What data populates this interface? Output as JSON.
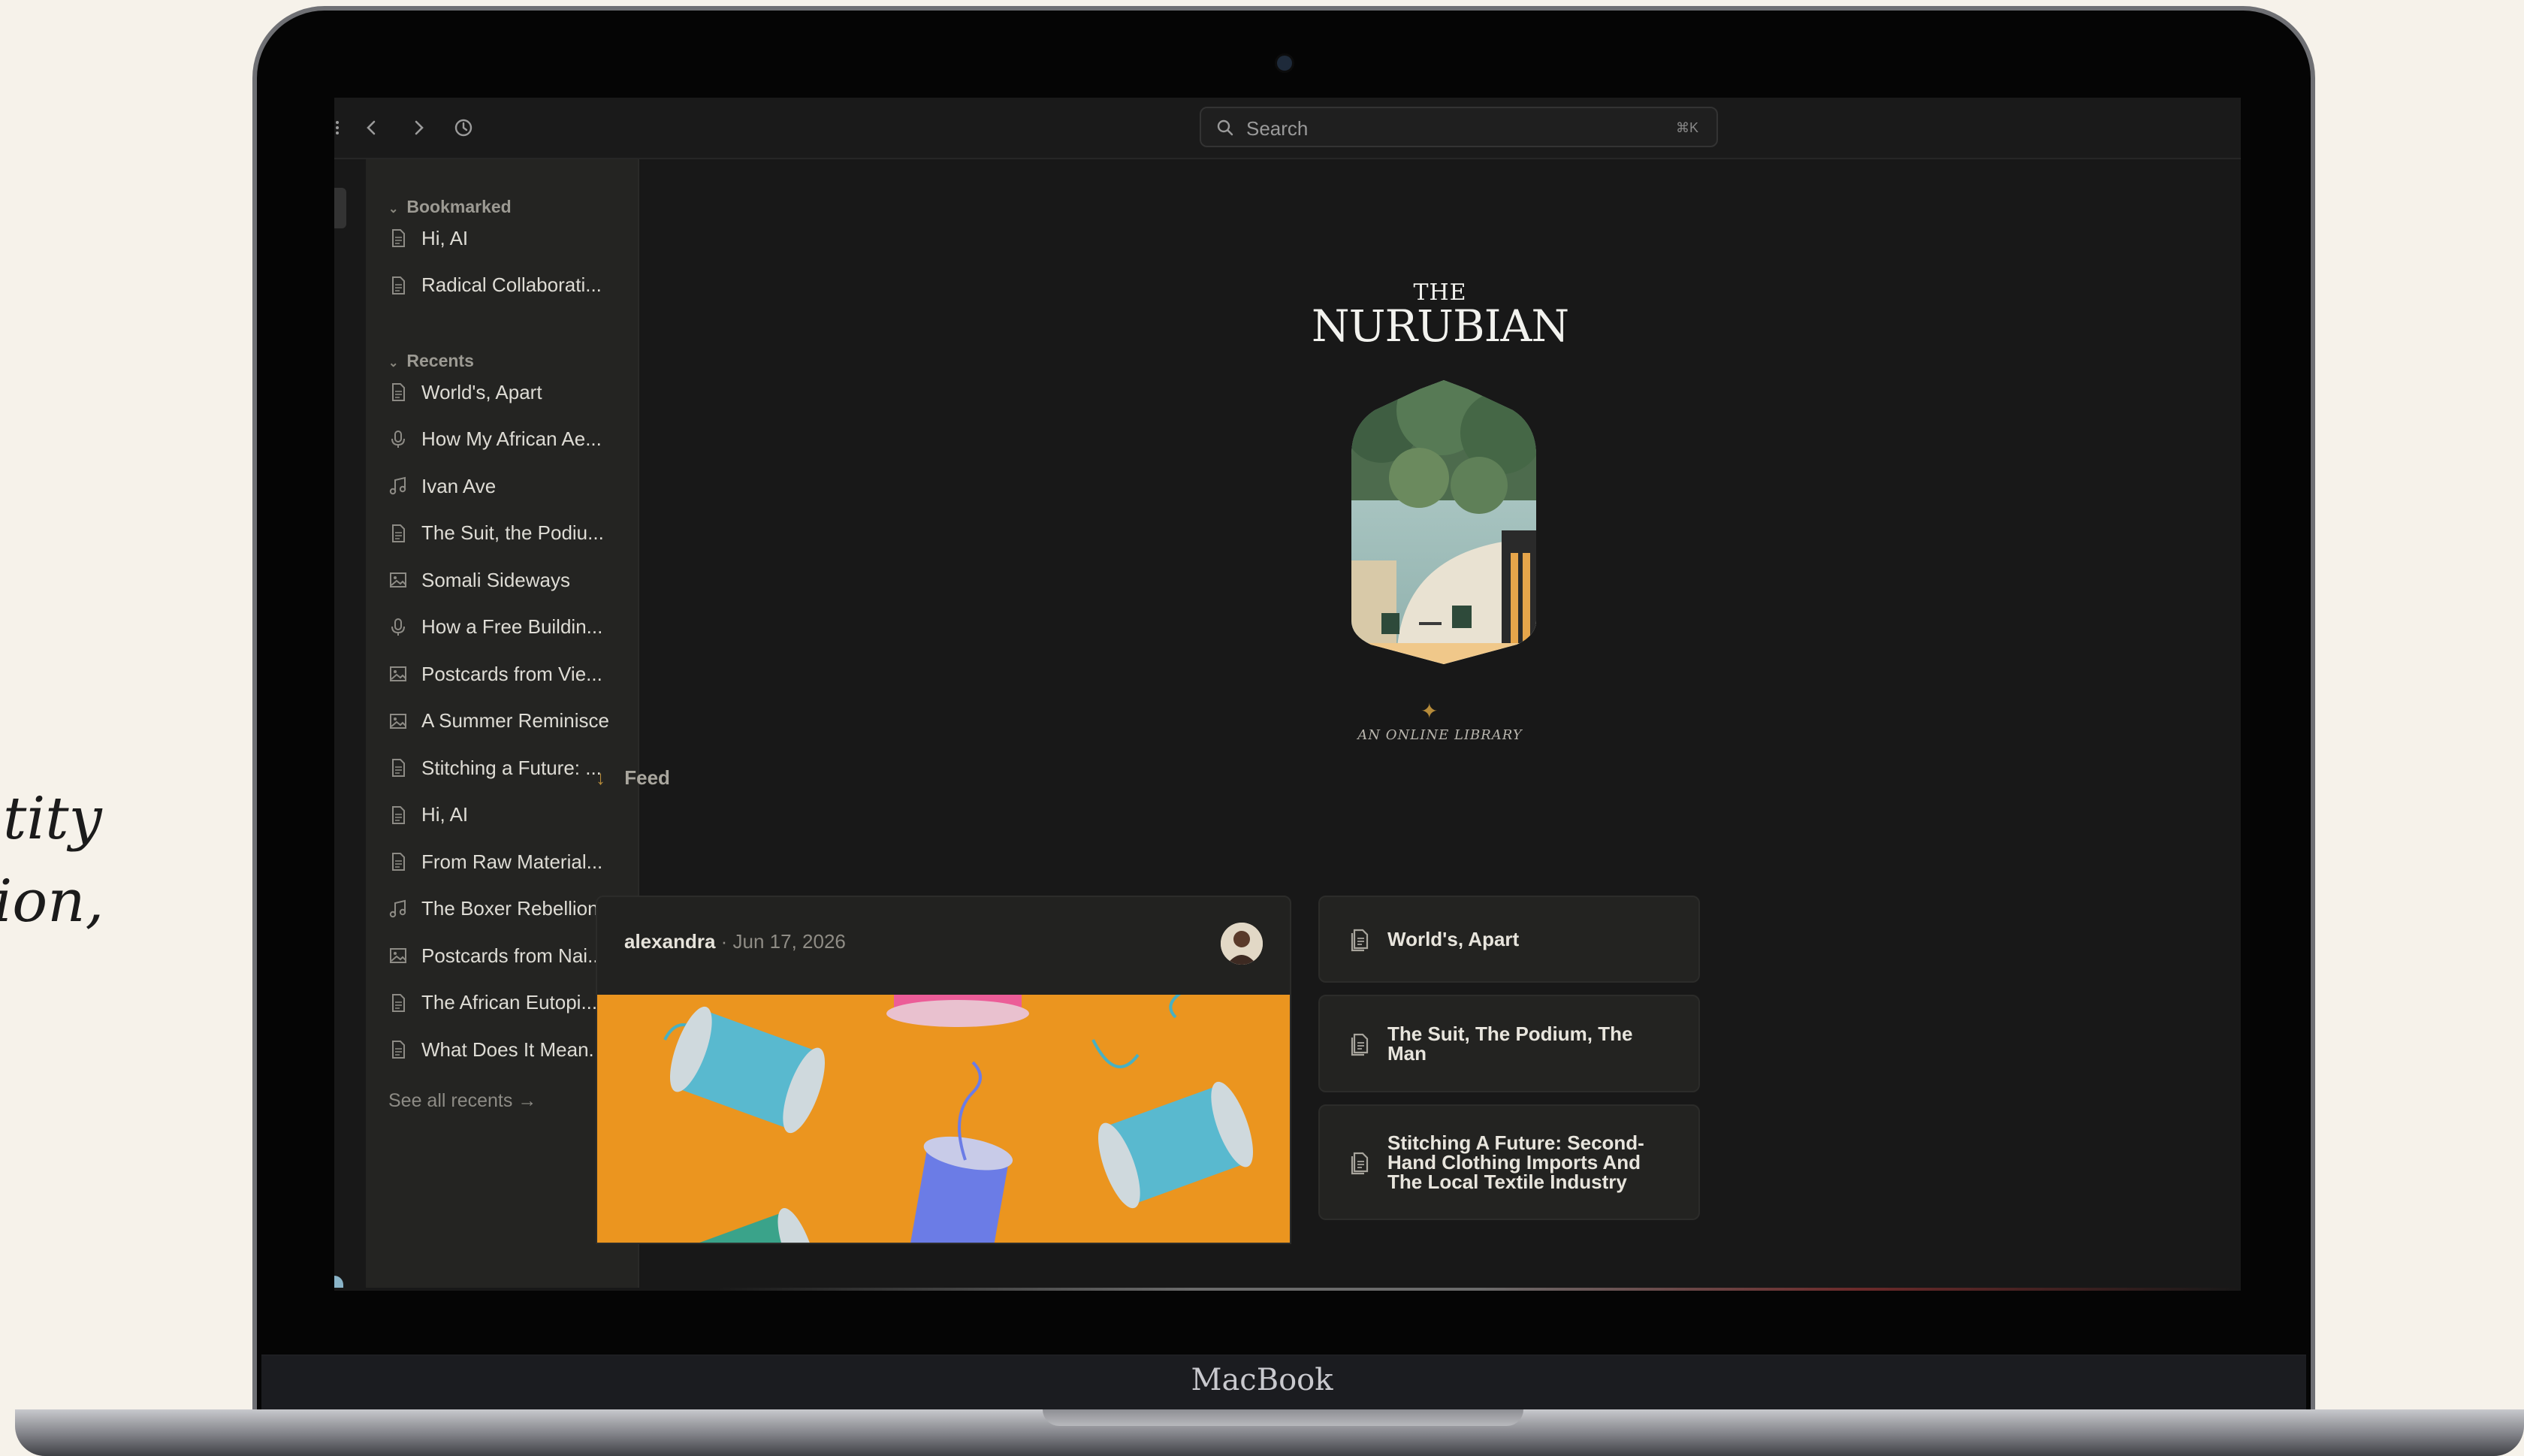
{
  "background_text": {
    "line1": "tity",
    "line2": "tion,"
  },
  "device": {
    "brand": "MacBook"
  },
  "topbar": {
    "icons": [
      "menu-dots-icon",
      "back-icon",
      "forward-icon",
      "history-icon"
    ],
    "search": {
      "placeholder": "Search",
      "shortcut": "⌘K"
    }
  },
  "sidebar": {
    "bookmarked": {
      "title": "Bookmarked",
      "items": [
        {
          "label": "Hi, AI",
          "icon": "document-icon"
        },
        {
          "label": "Radical Collaborati...",
          "icon": "document-icon"
        }
      ]
    },
    "recents": {
      "title": "Recents",
      "items": [
        {
          "label": "World's, Apart",
          "icon": "document-icon"
        },
        {
          "label": "How My African Ae...",
          "icon": "microphone-icon"
        },
        {
          "label": "Ivan Ave",
          "icon": "music-note-icon"
        },
        {
          "label": "The Suit, the Podiu...",
          "icon": "document-icon"
        },
        {
          "label": "Somali Sideways",
          "icon": "image-icon"
        },
        {
          "label": "How a Free Buildin...",
          "icon": "microphone-icon"
        },
        {
          "label": "Postcards from Vie...",
          "icon": "image-icon"
        },
        {
          "label": "A Summer Reminisce",
          "icon": "image-icon"
        },
        {
          "label": "Stitching a Future: ...",
          "icon": "document-icon"
        },
        {
          "label": "Hi, AI",
          "icon": "document-icon"
        },
        {
          "label": "From Raw Material...",
          "icon": "document-icon"
        },
        {
          "label": "The Boxer Rebellion",
          "icon": "music-note-icon"
        },
        {
          "label": "Postcards from Nai...",
          "icon": "image-icon"
        },
        {
          "label": "The African Eutopi...",
          "icon": "document-icon"
        },
        {
          "label": "What Does It Mean...",
          "icon": "document-icon"
        }
      ],
      "see_all": "See all recents →"
    }
  },
  "main": {
    "logo": {
      "the": "THE",
      "name": "NURUBIAN"
    },
    "tagline": "AN ONLINE LIBRARY",
    "feed": {
      "label": "Feed",
      "post": {
        "author": "alexandra",
        "separator": " · ",
        "date": "Jun 17, 2026"
      },
      "side_cards": [
        {
          "title": "World's, Apart",
          "icon": "document-stack-icon"
        },
        {
          "title": "The Suit, The Podium, The Man",
          "icon": "document-stack-icon"
        },
        {
          "title": "Stitching A Future: Second-Hand Clothing Imports And The Local Textile Industry",
          "icon": "document-stack-icon"
        }
      ]
    }
  },
  "colors": {
    "accent": "#b68b3a",
    "screen_bg": "#181818",
    "sidebar_bg": "#242422",
    "page_bg": "#f6f2ea"
  }
}
